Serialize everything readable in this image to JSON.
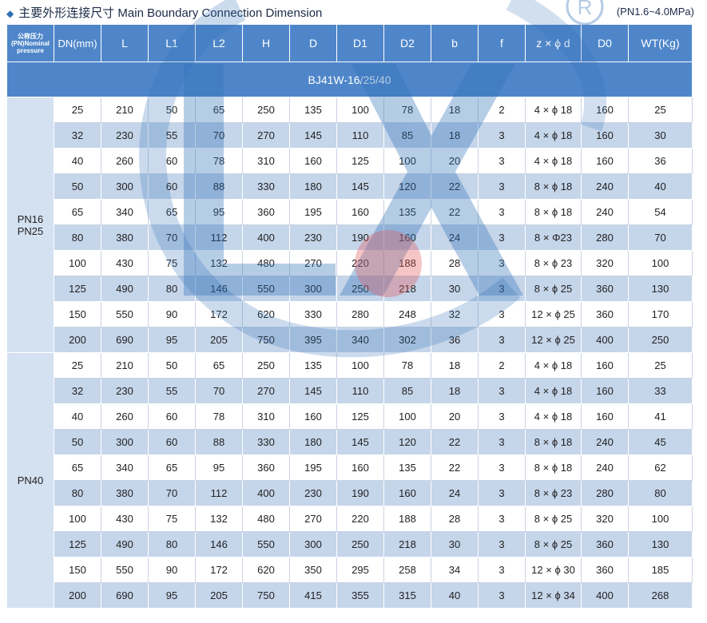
{
  "header": {
    "title": "主要外形连接尺寸 Main Boundary Connection Dimension",
    "pressure_range": "(PN1.6~4.0MPa)"
  },
  "table": {
    "pn_header": "公称压力(PN)Nominal pressure",
    "columns": [
      "DN(mm)",
      "L",
      "L1",
      "L2",
      "H",
      "D",
      "D1",
      "D2",
      "b",
      "f",
      "z × ϕ d",
      "D0",
      "WT(Kg)"
    ],
    "model": "BJ41W-16/25/40",
    "groups": [
      {
        "pn_lines": [
          "PN16",
          "PN25"
        ],
        "rows": [
          [
            "25",
            "210",
            "50",
            "65",
            "250",
            "135",
            "100",
            "78",
            "18",
            "2",
            "4 × ϕ 18",
            "160",
            "25"
          ],
          [
            "32",
            "230",
            "55",
            "70",
            "270",
            "145",
            "110",
            "85",
            "18",
            "3",
            "4 × ϕ 18",
            "160",
            "30"
          ],
          [
            "40",
            "260",
            "60",
            "78",
            "310",
            "160",
            "125",
            "100",
            "20",
            "3",
            "4 × ϕ 18",
            "160",
            "36"
          ],
          [
            "50",
            "300",
            "60",
            "88",
            "330",
            "180",
            "145",
            "120",
            "22",
            "3",
            "8 × ϕ 18",
            "240",
            "40"
          ],
          [
            "65",
            "340",
            "65",
            "95",
            "360",
            "195",
            "160",
            "135",
            "22",
            "3",
            "8 × ϕ 18",
            "240",
            "54"
          ],
          [
            "80",
            "380",
            "70",
            "112",
            "400",
            "230",
            "190",
            "160",
            "24",
            "3",
            "8 × Φ23",
            "280",
            "70"
          ],
          [
            "100",
            "430",
            "75",
            "132",
            "480",
            "270",
            "220",
            "188",
            "28",
            "3",
            "8 × ϕ 23",
            "320",
            "100"
          ],
          [
            "125",
            "490",
            "80",
            "146",
            "550",
            "300",
            "250",
            "218",
            "30",
            "3",
            "8 × ϕ 25",
            "360",
            "130"
          ],
          [
            "150",
            "550",
            "90",
            "172",
            "620",
            "330",
            "280",
            "248",
            "32",
            "3",
            "12 × ϕ 25",
            "360",
            "170"
          ],
          [
            "200",
            "690",
            "95",
            "205",
            "750",
            "395",
            "340",
            "302",
            "36",
            "3",
            "12 × ϕ 25",
            "400",
            "250"
          ]
        ]
      },
      {
        "pn_lines": [
          "PN40"
        ],
        "rows": [
          [
            "25",
            "210",
            "50",
            "65",
            "250",
            "135",
            "100",
            "78",
            "18",
            "2",
            "4 × ϕ 18",
            "160",
            "25"
          ],
          [
            "32",
            "230",
            "55",
            "70",
            "270",
            "145",
            "110",
            "85",
            "18",
            "3",
            "4 × ϕ 18",
            "160",
            "33"
          ],
          [
            "40",
            "260",
            "60",
            "78",
            "310",
            "160",
            "125",
            "100",
            "20",
            "3",
            "4 × ϕ 18",
            "160",
            "41"
          ],
          [
            "50",
            "300",
            "60",
            "88",
            "330",
            "180",
            "145",
            "120",
            "22",
            "3",
            "8 × ϕ 18",
            "240",
            "45"
          ],
          [
            "65",
            "340",
            "65",
            "95",
            "360",
            "195",
            "160",
            "135",
            "22",
            "3",
            "8 × ϕ 18",
            "240",
            "62"
          ],
          [
            "80",
            "380",
            "70",
            "112",
            "400",
            "230",
            "190",
            "160",
            "24",
            "3",
            "8 × ϕ 23",
            "280",
            "80"
          ],
          [
            "100",
            "430",
            "75",
            "132",
            "480",
            "270",
            "220",
            "188",
            "28",
            "3",
            "8 × ϕ 25",
            "320",
            "100"
          ],
          [
            "125",
            "490",
            "80",
            "146",
            "550",
            "300",
            "250",
            "218",
            "30",
            "3",
            "8 × ϕ 25",
            "360",
            "130"
          ],
          [
            "150",
            "550",
            "90",
            "172",
            "620",
            "350",
            "295",
            "258",
            "34",
            "3",
            "12 × ϕ 30",
            "360",
            "185"
          ],
          [
            "200",
            "690",
            "95",
            "205",
            "750",
            "415",
            "355",
            "315",
            "40",
            "3",
            "12 × ϕ 34",
            "400",
            "268"
          ]
        ]
      }
    ]
  },
  "colors": {
    "header_blue": "#4f86c9",
    "row_alt": "#c5d5ea",
    "watermark": "#2f6fb6",
    "title_marker": "#2f6fb6"
  },
  "watermark_icon": "registered-mark-icon"
}
